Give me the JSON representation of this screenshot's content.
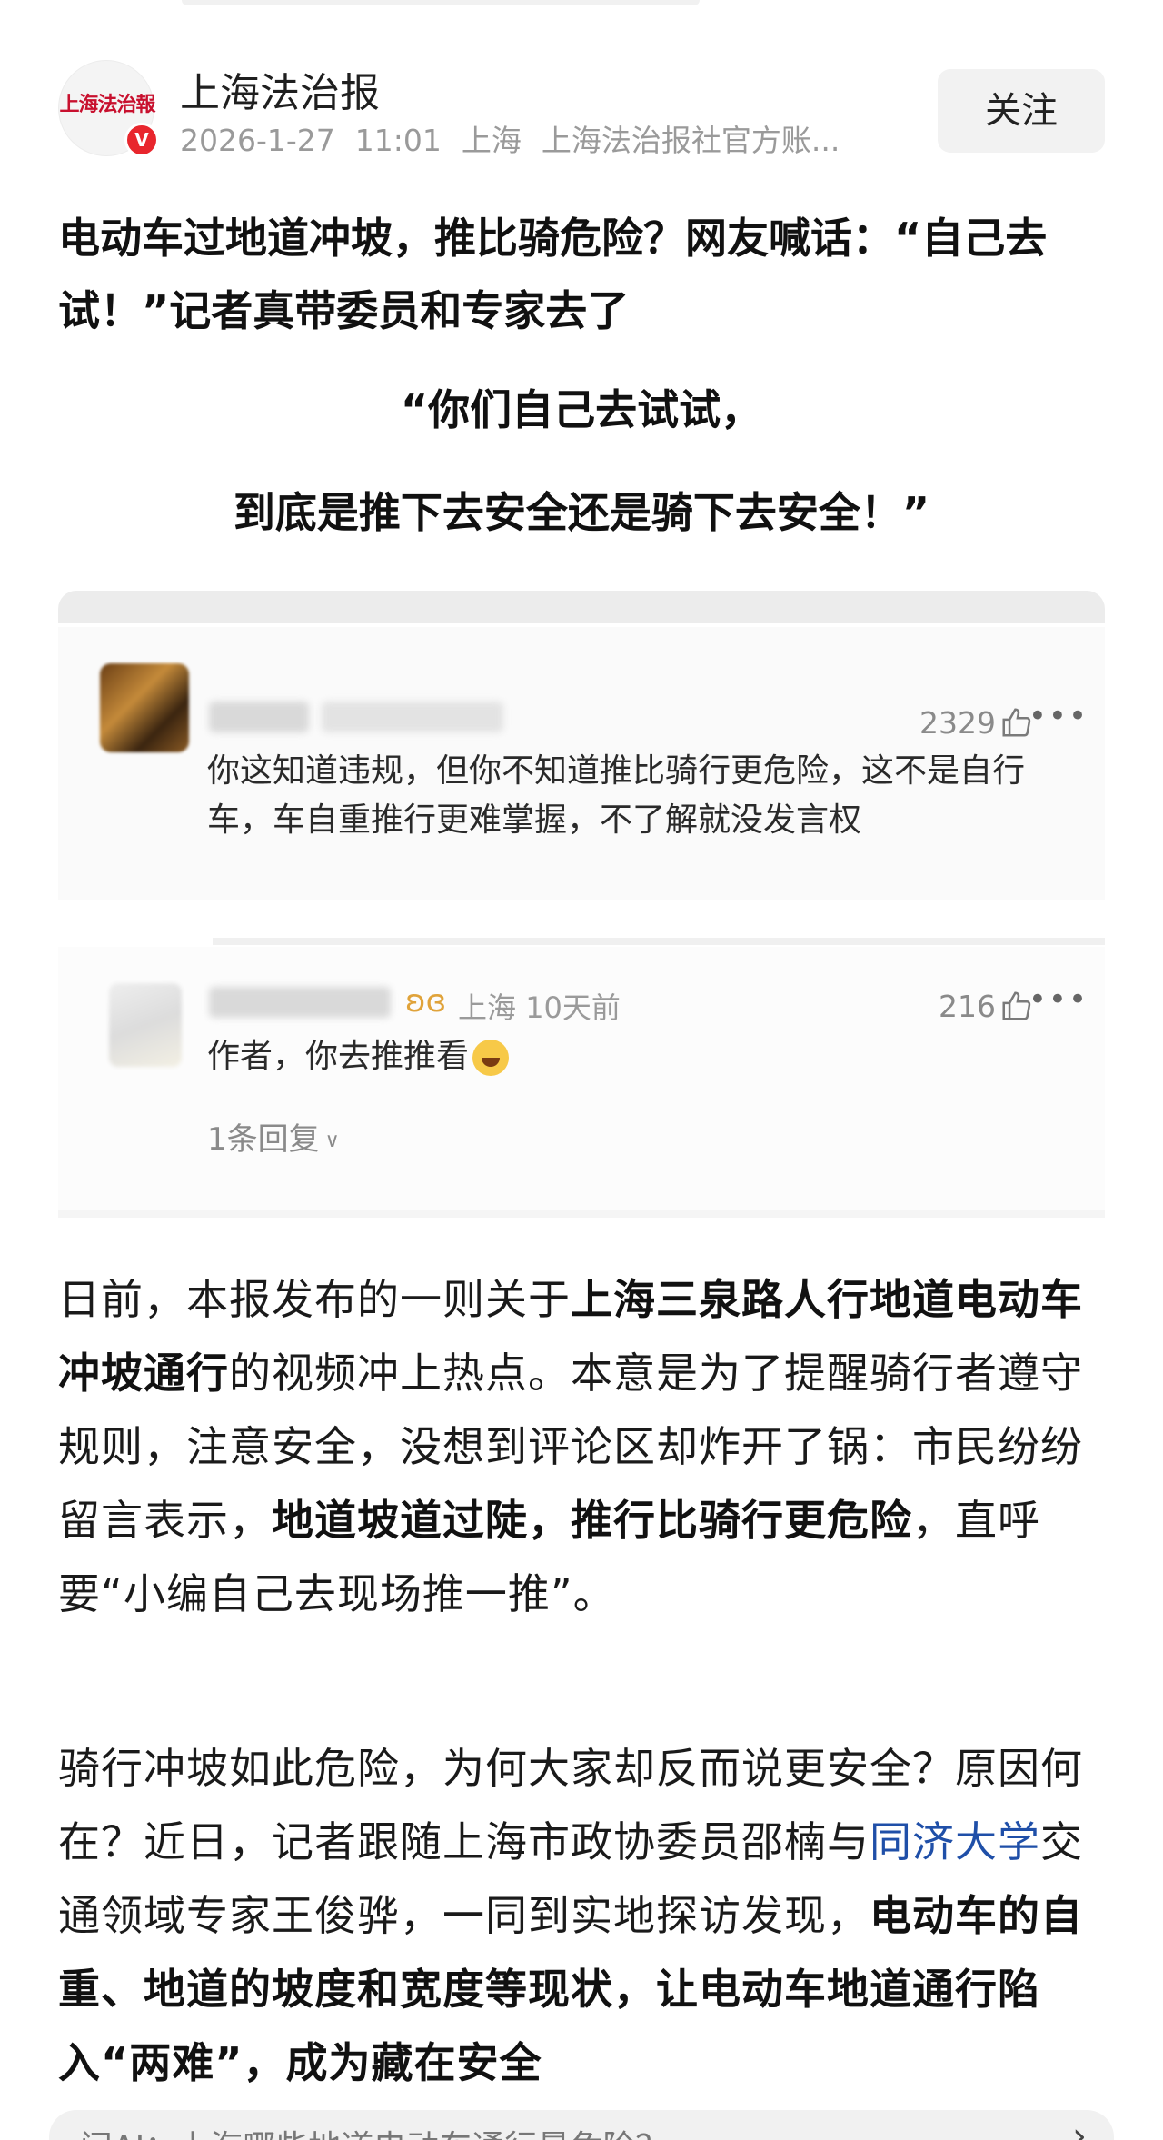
{
  "account": {
    "name": "上海法治报",
    "logo_text": "上海法治報",
    "verified_badge": "V",
    "date": "2026-1-27",
    "time": "11:01",
    "location": "上海",
    "description": "上海法治报社官方账...",
    "follow_label": "关注"
  },
  "article": {
    "title": "电动车过地道冲坡，推比骑危险？网友喊话：“自己去试！”记者真带委员和专家去了",
    "quote_line1": "“你们自己去试试，",
    "quote_line2": "到底是推下去安全还是骑下去安全！”",
    "para1": {
      "t1": "日前，本报发布的一则关于",
      "b1": "上海三泉路人行地道电动车冲坡通行",
      "t2": "的视频冲上热点。本意是为了提醒骑行者遵守规则，注意安全，没想到评论区却炸开了锅：市民纷纷留言表示，",
      "b2": "地道坡道过陡，推行比骑行更危险",
      "t3": "，直呼要“小编自己去现场推一推”。"
    },
    "para2": {
      "t1": "骑行冲坡如此危险，为何大家却反而说更安全？原因何在？近日，记者跟随上海市政协委员邵楠与",
      "link": "同济大学",
      "t2": "交通领域专家王俊骅，一同到实地探访发现，",
      "b1": "电动车的自重、地道的坡度和宽度等现状，让电动车地道通行陷入“两难”，成为藏在安全"
    }
  },
  "comments": [
    {
      "likes": "2329",
      "text": "你这知道违规，但你不知道推比骑行更危险，这不是自行车，车自重推行更难掌握，不了解就没发言权"
    },
    {
      "location": "上海",
      "time": "10天前",
      "likes": "216",
      "text": "作者，你去推推看",
      "replies": "1条回复"
    }
  ],
  "ai_bar": {
    "text": "问AI：上海哪些地道电动车通行最危险？",
    "arrow": "›"
  },
  "icons": {
    "thumb": "thumbs-up-icon",
    "more": "more-dots-icon",
    "chevron": "chevron-down-icon",
    "vip": "vip-wings-icon"
  },
  "colors": {
    "verified": "#e8262d",
    "link": "#1f4fa8",
    "logo": "#c8102e"
  }
}
